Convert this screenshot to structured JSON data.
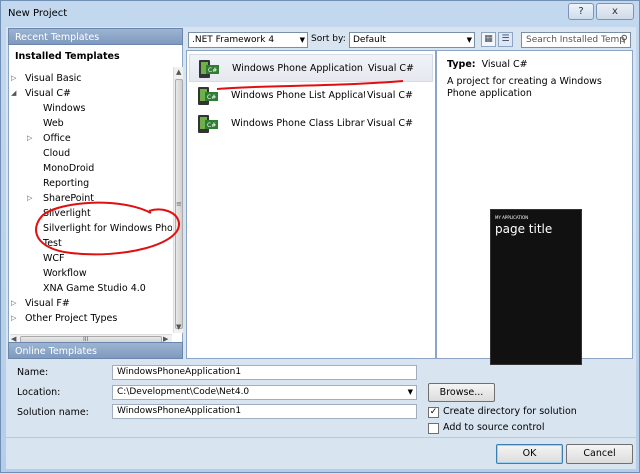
{
  "window": {
    "title": "New Project",
    "help_label": "?",
    "close_label": "x"
  },
  "left": {
    "recent_header": "Recent Templates",
    "installed_header": "Installed Templates",
    "tree": [
      {
        "label": "Visual Basic",
        "expander": "▷",
        "depth": 0
      },
      {
        "label": "Visual C#",
        "expander": "◢",
        "depth": 0
      },
      {
        "label": "Windows",
        "expander": "",
        "depth": 1
      },
      {
        "label": "Web",
        "expander": "",
        "depth": 1
      },
      {
        "label": "Office",
        "expander": "▷",
        "depth": 1
      },
      {
        "label": "Cloud",
        "expander": "",
        "depth": 1
      },
      {
        "label": "MonoDroid",
        "expander": "",
        "depth": 1
      },
      {
        "label": "Reporting",
        "expander": "",
        "depth": 1
      },
      {
        "label": "SharePoint",
        "expander": "▷",
        "depth": 1
      },
      {
        "label": "Silverlight",
        "expander": "",
        "depth": 1
      },
      {
        "label": "Silverlight for Windows Phone",
        "expander": "",
        "depth": 1
      },
      {
        "label": "Test",
        "expander": "",
        "depth": 1
      },
      {
        "label": "WCF",
        "expander": "",
        "depth": 1
      },
      {
        "label": "Workflow",
        "expander": "",
        "depth": 1
      },
      {
        "label": "XNA Game Studio 4.0",
        "expander": "",
        "depth": 1
      },
      {
        "label": "Visual F#",
        "expander": "▷",
        "depth": 0
      },
      {
        "label": "Other Project Types",
        "expander": "▷",
        "depth": 0
      }
    ],
    "scroll_grip": "≡",
    "hscroll_grip": "III",
    "online_header": "Online Templates"
  },
  "toolbar": {
    "framework": ".NET Framework 4",
    "sort_by_label": "Sort by:",
    "sort_value": "Default",
    "search_placeholder": "Search Installed Temp"
  },
  "templates": [
    {
      "name": "Windows Phone Application",
      "lang": "Visual C#",
      "selected": true
    },
    {
      "name": "Windows Phone List Applicati...",
      "lang": "Visual C#",
      "selected": false
    },
    {
      "name": "Windows Phone Class Library",
      "lang": "Visual C#",
      "selected": false
    }
  ],
  "info": {
    "type_label": "Type:",
    "type_value": "Visual C#",
    "description": "A project for creating a Windows Phone application",
    "preview_app": "MY APPLICATION",
    "preview_title": "page title"
  },
  "form": {
    "name_label": "Name:",
    "name_value": "WindowsPhoneApplication1",
    "location_label": "Location:",
    "location_value": "C:\\Development\\Code\\Net4.0",
    "solution_label": "Solution name:",
    "solution_value": "WindowsPhoneApplication1",
    "browse_label": "Browse...",
    "create_dir_label": "Create directory for solution",
    "create_dir_checked": "✓",
    "source_control_label": "Add to source control"
  },
  "buttons": {
    "ok": "OK",
    "cancel": "Cancel"
  }
}
